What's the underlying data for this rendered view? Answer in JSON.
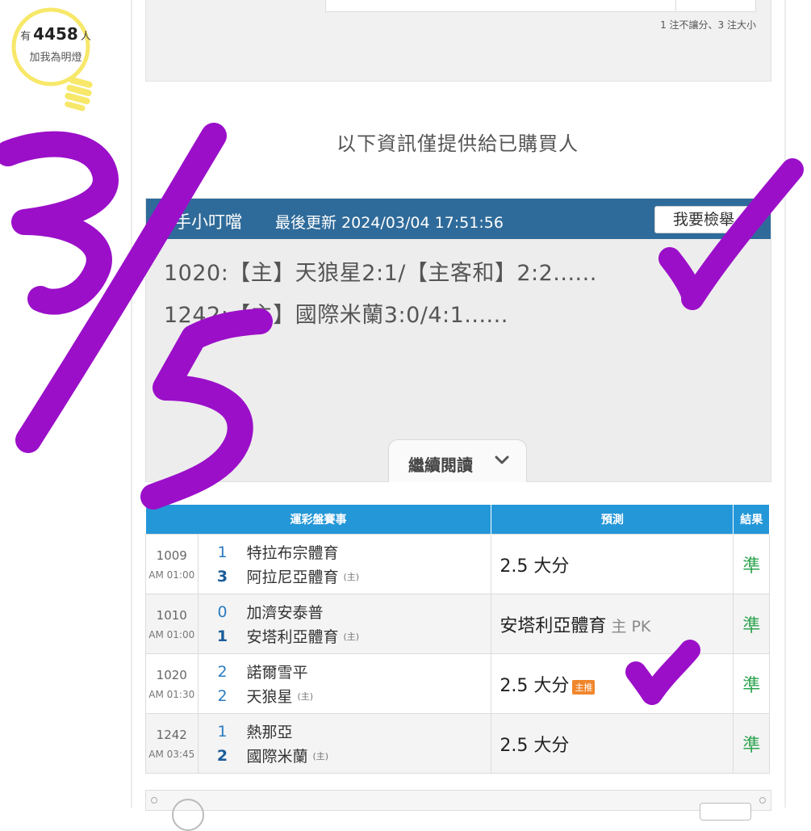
{
  "lamp": {
    "count_prefix": "有",
    "count": "4458",
    "count_suffix": "人",
    "label": "加我為明燈"
  },
  "top_panel": {
    "note": "1 注不讓分、3 注大小"
  },
  "info_heading": "以下資訊僅提供給已購買人",
  "card": {
    "expert_name": "殺手小叮噹",
    "update_line": "最後更新 2024/03/04 17:51:56",
    "report_button": "我要檢舉",
    "picks": [
      "1020:【主】天狼星2:1/【主客和】2:2......",
      "1242:【主】國際米蘭3:0/4:1......"
    ],
    "read_more": "繼續閱讀"
  },
  "table": {
    "headers": [
      "運彩盤賽事",
      "預測",
      "結果"
    ],
    "rows": [
      {
        "game_no": "1009",
        "time": "AM 01:00",
        "away_score": "1",
        "away_team": "特拉布宗體育",
        "home_score": "3",
        "home_team": "阿拉尼亞體育",
        "home_mark": "(主)",
        "prediction": "2.5 大分",
        "prediction_extra": "",
        "tag": "",
        "result": "準"
      },
      {
        "game_no": "1010",
        "time": "AM 01:00",
        "away_score": "0",
        "away_team": "加濟安泰普",
        "home_score": "1",
        "home_team": "安塔利亞體育",
        "home_mark": "(主)",
        "prediction": "安塔利亞體育",
        "prediction_extra": "主 PK",
        "tag": "",
        "result": "準"
      },
      {
        "game_no": "1020",
        "time": "AM 01:30",
        "away_score": "2",
        "away_team": "諾爾雪平",
        "home_score": "2",
        "home_team": "天狼星",
        "home_mark": "(主)",
        "prediction": "2.5 大分",
        "prediction_extra": "",
        "tag": "主推",
        "result": "準"
      },
      {
        "game_no": "1242",
        "time": "AM 03:45",
        "away_score": "1",
        "away_team": "熱那亞",
        "home_score": "2",
        "home_team": "國際米蘭",
        "home_mark": "(主)",
        "prediction": "2.5 大分",
        "prediction_extra": "",
        "tag": "",
        "result": "準"
      }
    ]
  },
  "handwriting": {
    "ink_color": "#9b0fc9",
    "marks": [
      "3/5",
      "checkmark",
      "checkmark"
    ]
  }
}
